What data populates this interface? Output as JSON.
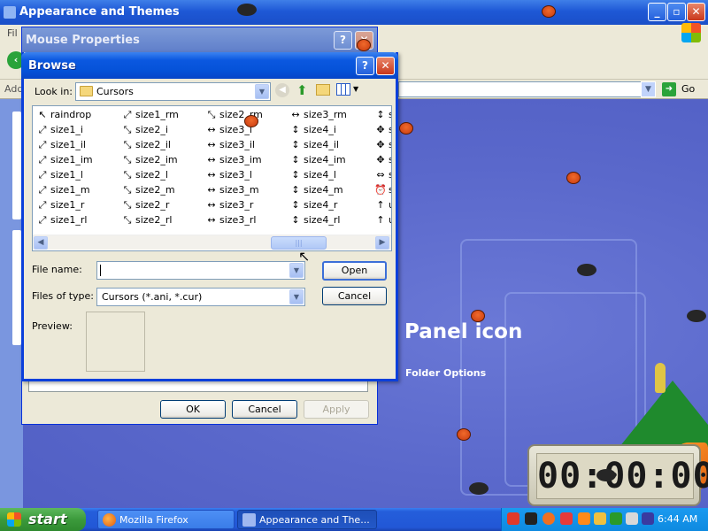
{
  "background_window": {
    "title": "Appearance and Themes",
    "menu_first": "Fil",
    "address_label": "Add",
    "go_label": "Go",
    "control_panel_title": "Panel icon",
    "folder_options": "Folder Options"
  },
  "mouse_properties": {
    "title": "Mouse Properties",
    "ok_label": "OK",
    "cancel_label": "Cancel",
    "apply_label": "Apply"
  },
  "browse": {
    "title": "Browse",
    "look_in_label": "Look in:",
    "look_in_value": "Cursors",
    "files": {
      "col1": [
        "raindrop",
        "size1_i",
        "size1_il",
        "size1_im",
        "size1_l",
        "size1_m",
        "size1_r",
        "size1_rl"
      ],
      "col2": [
        "size1_rm",
        "size2_i",
        "size2_il",
        "size2_im",
        "size2_l",
        "size2_m",
        "size2_r",
        "size2_rl"
      ],
      "col3": [
        "size2_rm",
        "size3_i",
        "size3_il",
        "size3_im",
        "size3_l",
        "size3_m",
        "size3_r",
        "size3_rl"
      ],
      "col4": [
        "size3_rm",
        "size4_i",
        "size4_il",
        "size4_im",
        "size4_l",
        "size4_m",
        "size4_r",
        "size4_rl"
      ],
      "col5": [
        "s",
        "s",
        "s",
        "s",
        "s",
        "s",
        "u",
        "u"
      ]
    },
    "file_name_label": "File name:",
    "file_name_value": "",
    "files_of_type_label": "Files of type:",
    "files_of_type_value": "Cursors (*.ani, *.cur)",
    "open_label": "Open",
    "cancel_label": "Cancel",
    "preview_label": "Preview:"
  },
  "clock_widget": {
    "display": "00:00:00"
  },
  "taskbar": {
    "start_label": "start",
    "tasks": [
      "Mozilla Firefox",
      "Appearance and The..."
    ],
    "time": "6:44 AM"
  },
  "colors": {
    "xp_blue": "#0552d8",
    "desktop": "#5a66c8",
    "start_green": "#3c9a3c",
    "tray_blue": "#0e8ae0"
  }
}
